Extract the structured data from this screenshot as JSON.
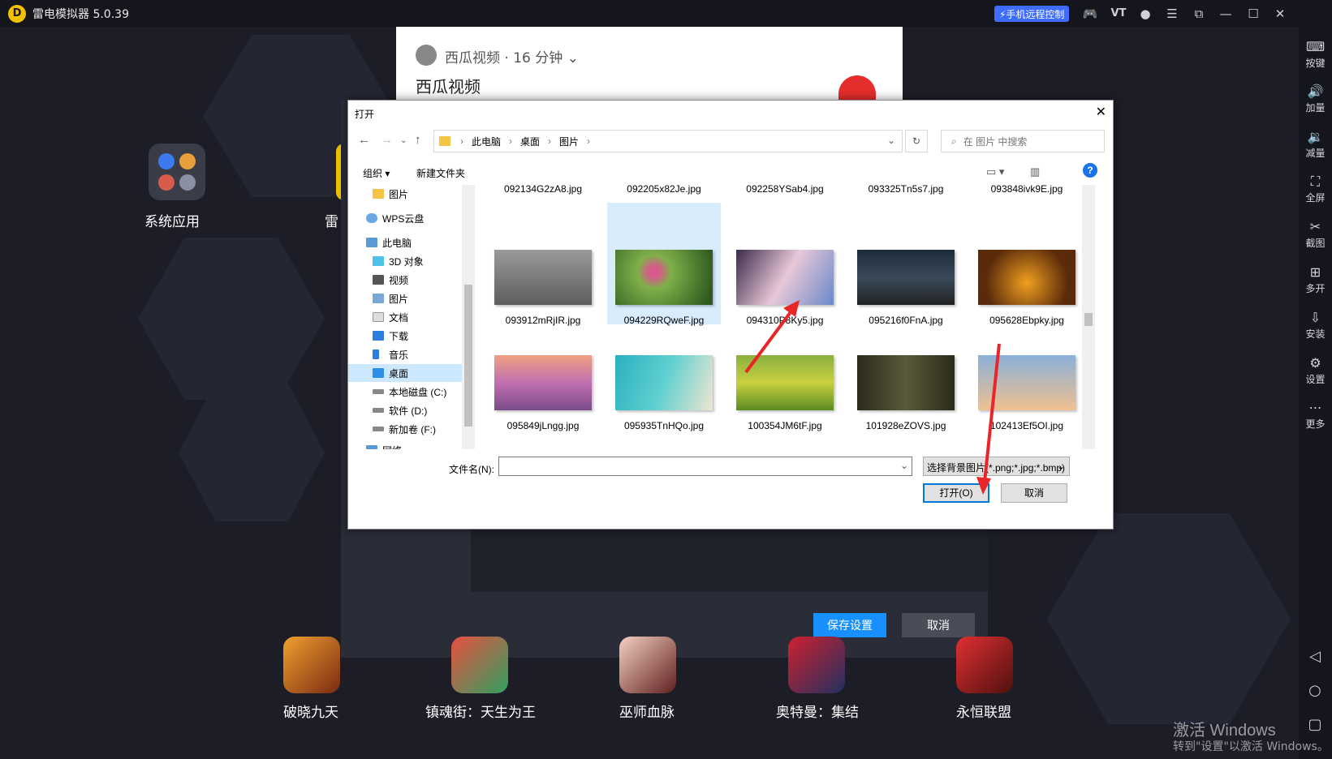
{
  "titlebar": {
    "logo": "D",
    "title": "雷电模拟器 5.0.39",
    "remote": "⚡手机远程控制",
    "vt": "VT"
  },
  "sidebar": [
    {
      "icon": "keyboard-icon",
      "glyph": "⌨",
      "label": "按键"
    },
    {
      "icon": "volume-up-icon",
      "glyph": "🔊",
      "label": "加量"
    },
    {
      "icon": "volume-down-icon",
      "glyph": "🔉",
      "label": "减量"
    },
    {
      "icon": "fullscreen-icon",
      "glyph": "⛶",
      "label": "全屏"
    },
    {
      "icon": "screenshot-icon",
      "glyph": "✂",
      "label": "截图"
    },
    {
      "icon": "multi-instance-icon",
      "glyph": "⊞",
      "label": "多开"
    },
    {
      "icon": "apk-install-icon",
      "glyph": "⇩",
      "label": "安装"
    },
    {
      "icon": "settings-icon",
      "glyph": "⚙",
      "label": "设置"
    },
    {
      "icon": "more-icon",
      "glyph": "⋯",
      "label": "更多"
    }
  ],
  "desktop": {
    "sys_app": "系统应用",
    "partial_app": "雷",
    "video_source": "西瓜视频 · 16 分钟 ⌄",
    "video_title": "西瓜视频",
    "apps": [
      "破晓九天",
      "镇魂街：天生为王",
      "巫师血脉",
      "奥特曼：集结",
      "永恒联盟"
    ]
  },
  "settings": {
    "save": "保存设置",
    "cancel": "取消"
  },
  "dialog": {
    "title": "打开",
    "close": "✕",
    "breadcrumbs": [
      "此电脑",
      "桌面",
      "图片"
    ],
    "search_placeholder": "在 图片 中搜索",
    "organize": "组织 ▾",
    "new_folder": "新建文件夹",
    "tree": [
      "图片",
      "WPS云盘",
      "此电脑",
      "3D 对象",
      "视频",
      "图片",
      "文档",
      "下载",
      "音乐",
      "桌面",
      "本地磁盘 (C:)",
      "软件 (D:)",
      "新加卷 (F:)",
      "网络"
    ],
    "files_row0": [
      "092134G2zA8.jpg",
      "092205x82Je.jpg",
      "092258YSab4.jpg",
      "093325Tn5s7.jpg",
      "093848ivk9E.jpg"
    ],
    "files_row1": [
      "093912mRjIR.jpg",
      "094229RQweF.jpg",
      "094310P8Ky5.jpg",
      "095216f0FnA.jpg",
      "095628Ebpky.jpg"
    ],
    "files_row2": [
      "095849jLngg.jpg",
      "095935TnHQo.jpg",
      "100354JM6tF.jpg",
      "101928eZOVS.jpg",
      "102413Ef5OI.jpg"
    ],
    "filename_label": "文件名(N):",
    "filename_value": "",
    "filter": "选择背景图片(*.png;*.jpg;*.bmp)",
    "open": "打开(O)",
    "cancel": "取消"
  },
  "watermark": {
    "line1": "激活 Windows",
    "line2": "转到\"设置\"以激活 Windows。"
  }
}
